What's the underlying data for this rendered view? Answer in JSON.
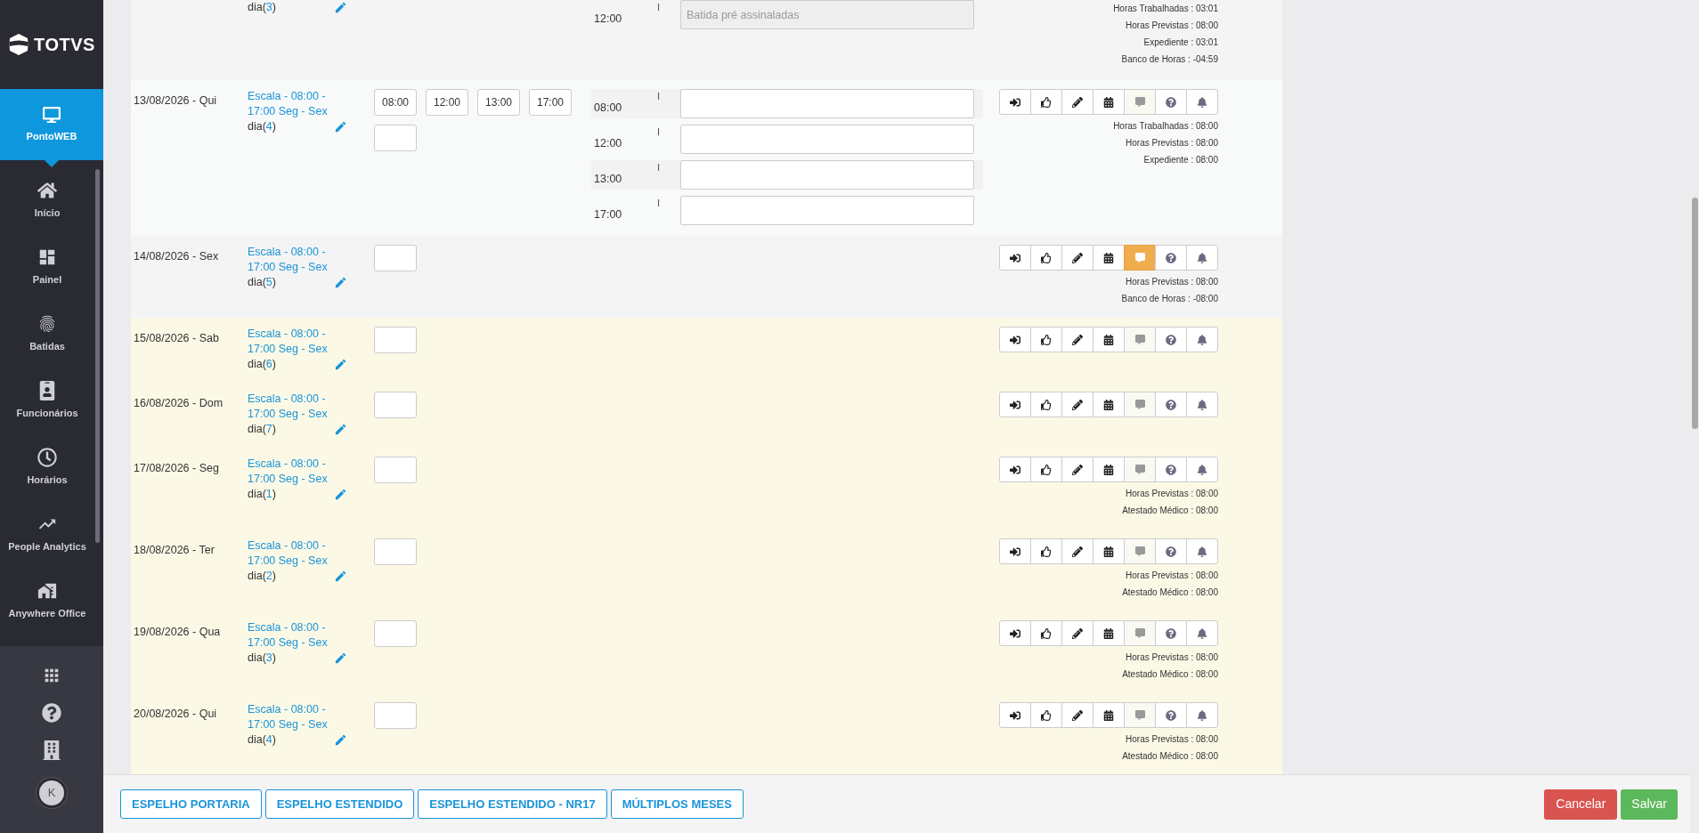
{
  "sidebar": {
    "logo": "TOTVS",
    "module": {
      "label": "PontoWEB",
      "selected": true
    },
    "nav": [
      {
        "label": "Início",
        "kind": "home"
      },
      {
        "label": "Painel",
        "kind": "dashboard"
      },
      {
        "label": "Batidas",
        "kind": "fingerprint"
      },
      {
        "label": "Funcionários",
        "kind": "badge"
      },
      {
        "label": "Horários",
        "kind": "clock"
      },
      {
        "label": "People Analytics",
        "kind": "trend"
      },
      {
        "label": "Anywhere Office",
        "kind": "office"
      }
    ],
    "footer": [
      {
        "kind": "apps"
      },
      {
        "kind": "help"
      },
      {
        "kind": "building"
      }
    ],
    "avatar": "K"
  },
  "rows": [
    {
      "color": "#f4f4f4",
      "day": {
        "prefix": "dia(",
        "number": "3",
        "suffix": ")"
      },
      "marks": [
        {
          "time": "12:00",
          "marker": "I",
          "placeholder": "Batida pré assinaladas",
          "disabled": true
        }
      ],
      "summary": [
        "Horas Trabalhadas : 03:01",
        "Horas Previstas : 08:00",
        "Expediente : 03:01",
        "Banco de Horas : -04:59"
      ]
    },
    {
      "color": "#f8f9f9",
      "date": "13/08/2026 - Qui",
      "schedule": "Escala - 08:00 - 17:00 Seg - Sex",
      "day": {
        "prefix": "dia(",
        "number": "4",
        "suffix": ")"
      },
      "punches": [
        "08:00",
        "12:00",
        "13:00",
        "17:00"
      ],
      "marks": [
        {
          "time": "08:00",
          "marker": "I",
          "disabled": false
        },
        {
          "time": "12:00",
          "marker": "I",
          "disabled": false
        },
        {
          "time": "13:00",
          "marker": "I",
          "disabled": false
        },
        {
          "time": "17:00",
          "marker": "I",
          "disabled": false
        }
      ],
      "highlighted": false,
      "summary": [
        "Horas Trabalhadas : 08:00",
        "Horas Previstas : 08:00",
        "Expediente : 08:00"
      ]
    },
    {
      "color": "#f4f4f4",
      "date": "14/08/2026 - Sex",
      "schedule": "Escala - 08:00 - 17:00 Seg - Sex",
      "day": {
        "prefix": "dia(",
        "number": "5",
        "suffix": ")"
      },
      "highlighted": true,
      "summary": [
        "Horas Previstas : 08:00",
        "Banco de Horas : -08:00"
      ]
    },
    {
      "color": "#fbf9e6",
      "date": "15/08/2026 - Sab",
      "schedule": "Escala - 08:00 - 17:00 Seg - Sex",
      "day": {
        "prefix": "dia(",
        "number": "6",
        "suffix": ")"
      },
      "highlighted": false
    },
    {
      "color": "#fbf9e6",
      "date": "16/08/2026 - Dom",
      "schedule": "Escala - 08:00 - 17:00 Seg - Sex",
      "day": {
        "prefix": "dia(",
        "number": "7",
        "suffix": ")"
      },
      "highlighted": false
    },
    {
      "color": "#fbf9e6",
      "date": "17/08/2026 - Seg",
      "schedule": "Escala - 08:00 - 17:00 Seg - Sex",
      "day": {
        "prefix": "dia(",
        "number": "1",
        "suffix": ")"
      },
      "highlighted": false,
      "summary": [
        "Horas Previstas : 08:00",
        "Atestado Médico : 08:00"
      ]
    },
    {
      "color": "#fbf9e6",
      "date": "18/08/2026 - Ter",
      "schedule": "Escala - 08:00 - 17:00 Seg - Sex",
      "day": {
        "prefix": "dia(",
        "number": "2",
        "suffix": ")"
      },
      "highlighted": false,
      "summary": [
        "Horas Previstas : 08:00",
        "Atestado Médico : 08:00"
      ]
    },
    {
      "color": "#fbf9e6",
      "date": "19/08/2026 - Qua",
      "schedule": "Escala - 08:00 - 17:00 Seg - Sex",
      "day": {
        "prefix": "dia(",
        "number": "3",
        "suffix": ")"
      },
      "highlighted": false,
      "summary": [
        "Horas Previstas : 08:00",
        "Atestado Médico : 08:00"
      ]
    },
    {
      "color": "#fbf9e6",
      "date": "20/08/2026 - Qui",
      "schedule": "Escala - 08:00 - 17:00 Seg - Sex",
      "day": {
        "prefix": "dia(",
        "number": "4",
        "suffix": ")"
      },
      "highlighted": false,
      "summary": [
        "Horas Previstas : 08:00",
        "Atestado Médico : 08:00"
      ]
    }
  ],
  "footer": {
    "reports": [
      "ESPELHO PORTARIA",
      "ESPELHO ESTENDIDO",
      "ESPELHO ESTENDIDO - NR17",
      "MÚLTIPLOS MESES"
    ],
    "cancel": "Cancelar",
    "save": "Salvar"
  }
}
